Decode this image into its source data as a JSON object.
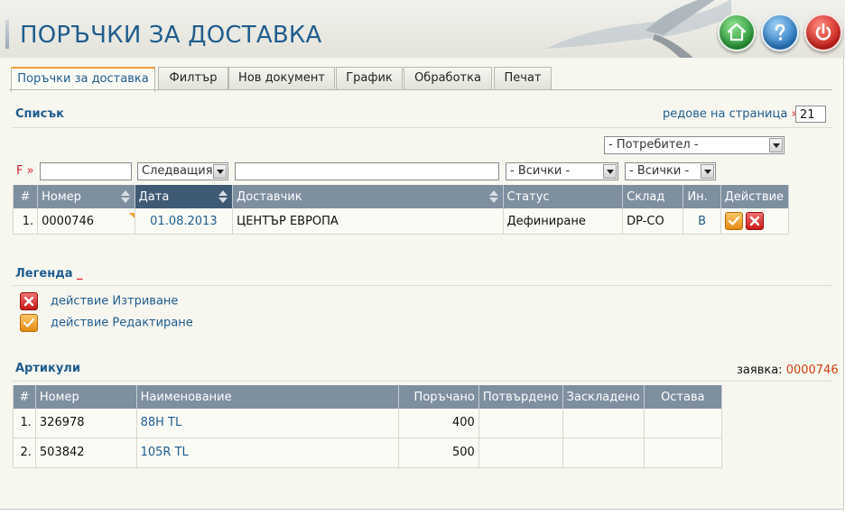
{
  "header": {
    "title": "ПОРЪЧКИ ЗА ДОСТАВКА"
  },
  "tabs": [
    {
      "label": "Поръчки за доставка",
      "active": true
    },
    {
      "label": "Филтър"
    },
    {
      "label": "Нов документ"
    },
    {
      "label": "График"
    },
    {
      "label": "Обработка"
    },
    {
      "label": "Печат"
    }
  ],
  "list": {
    "title": "Списък",
    "rows_per_page_label": "редове на страница",
    "rows_per_page_arrow": "»",
    "rows_per_page": "21",
    "consumer_select": "- Потребител -",
    "filter_tag": "F »",
    "filter_date_select": "Следващия",
    "filter_status_select": "- Всички -",
    "filter_warehouse_select": "- Всички -",
    "columns": [
      "#",
      "Номер",
      "Дата",
      "Доставчик",
      "Статус",
      "Склад",
      "Ин.",
      "Действие"
    ],
    "rows": [
      {
        "idx": "1.",
        "number": "0000746",
        "date": "01.08.2013",
        "supplier": "ЦЕНТЪР ЕВРОПА",
        "status": "Дефиниране",
        "warehouse": "DP-CO",
        "in": "B"
      }
    ]
  },
  "legend": {
    "title": "Легенда",
    "marker": "_",
    "items": [
      {
        "icon": "delete-icon",
        "label": "действие Изтриване"
      },
      {
        "icon": "edit-icon",
        "label": "действие Редактиране"
      }
    ]
  },
  "articles": {
    "title": "Артикули",
    "order_label": "заявка:",
    "order_number": "0000746",
    "columns": [
      "#",
      "Номер",
      "Наименование",
      "Поръчано",
      "Потвърдено",
      "Заскладено",
      "Остава"
    ],
    "rows": [
      {
        "idx": "1.",
        "number": "326978",
        "name": "88H TL",
        "ordered": "400",
        "confirmed": "",
        "stored": "",
        "remaining": ""
      },
      {
        "idx": "2.",
        "number": "503842",
        "name": "105R TL",
        "ordered": "500",
        "confirmed": "",
        "stored": "",
        "remaining": ""
      }
    ]
  },
  "colors": {
    "accent": "#1f5d8e",
    "header_bg": "#7e8fa0",
    "active_header": "#3f5a74",
    "tab_highlight": "#f0a032",
    "alert": "#dd2233"
  }
}
